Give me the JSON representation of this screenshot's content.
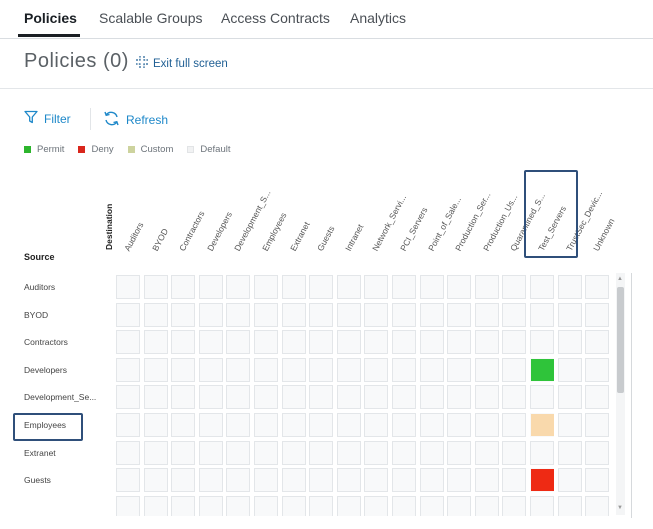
{
  "tabs": [
    {
      "label": "Policies",
      "active": true
    },
    {
      "label": "Scalable Groups",
      "active": false
    },
    {
      "label": "Access Contracts",
      "active": false
    },
    {
      "label": "Analytics",
      "active": false
    }
  ],
  "header": {
    "title": "Policies (0)",
    "exit_full_screen": "Exit full screen"
  },
  "toolbar": {
    "filter_label": "Filter",
    "refresh_label": "Refresh"
  },
  "legend": [
    {
      "label": "Permit",
      "color": "#2db52d"
    },
    {
      "label": "Deny",
      "color": "#d9261c"
    },
    {
      "label": "Custom",
      "color": "#cdd39e"
    },
    {
      "label": "Default",
      "color": "#f1f2f3"
    }
  ],
  "matrix": {
    "destination_label": "Destination",
    "source_label": "Source",
    "columns": [
      "Auditors",
      "BYOD",
      "Contractors",
      "Developers",
      "Development_S...",
      "Employees",
      "Extranet",
      "Guests",
      "Intranet",
      "Network_Servi...",
      "PCI_Servers",
      "Point_of_Sale...",
      "Production_Ser...",
      "Production_Us...",
      "Quarantined_S...",
      "Test_Servers",
      "TrustSec_Devic...",
      "Unknown"
    ],
    "rows": [
      "Auditors",
      "BYOD",
      "Contractors",
      "Developers",
      "Development_Se...",
      "Employees",
      "Extranet",
      "Guests"
    ],
    "highlighted_column": "Test_Servers",
    "highlighted_row": "Employees",
    "policy_cells": [
      {
        "row": "Developers",
        "column": "Test_Servers",
        "policy": "Permit",
        "color": "#2fc43a"
      },
      {
        "row": "Employees",
        "column": "Test_Servers",
        "policy": "Custom",
        "color": "#f9d9ac"
      },
      {
        "row": "Guests",
        "column": "Test_Servers",
        "policy": "Deny",
        "color": "#ee2a14"
      }
    ]
  }
}
